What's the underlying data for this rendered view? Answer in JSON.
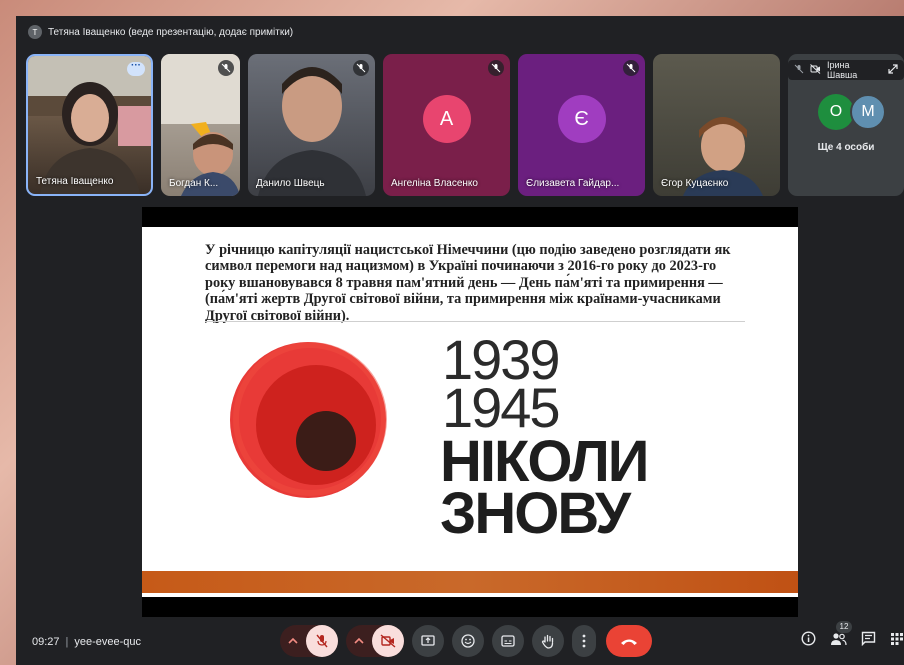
{
  "presenter_banner": {
    "avatar_letter": "Т",
    "text": "Тетяна Іващенко (веде презентацію, додає примітки)"
  },
  "participants": [
    {
      "name": "Тетяна Іващенко",
      "muted": false
    },
    {
      "name": "Богдан К...",
      "muted": true
    },
    {
      "name": "Данило Швець",
      "muted": true
    },
    {
      "name": "Ангеліна Власенко",
      "avatar_letter": "А",
      "muted": true
    },
    {
      "name": "Єлизавета Гайдар...",
      "avatar_letter": "Є",
      "muted": true
    },
    {
      "name": "Єгор Куцаєнко",
      "muted": true
    }
  ],
  "others": {
    "pinned_name": "Ірина Шавша",
    "avatars": [
      "О",
      "М"
    ],
    "count_label": "Ще 4 особи"
  },
  "slide": {
    "text": "У річницю капітуляції нацистської Німеччини (цю подію заведено розглядати як символ перемоги над нацизмом) в Україні починаючи з 2016-го року до 2023-го року вшановувався 8 травня пам'ятний день — День па́м'яті та примирення — (па́м'яті жертв Другої світової війни, та примирення між країнами-учасниками Другої світової війни).",
    "year1": "1939",
    "year2": "1945",
    "slogan1": "НІКОЛИ",
    "slogan2": "ЗНОВУ"
  },
  "bottom": {
    "time": "09:27",
    "meeting_code": "yee-evee-quc",
    "people_count": "12"
  },
  "colors": {
    "meet_bg": "#202124",
    "angelina_tile": "#7a1f4a",
    "angelina_avatar": "#e8456f",
    "yelyzaveta_tile": "#6b1f7f",
    "yelyzaveta_avatar": "#a03dc0",
    "avatar_o": "#1e8e3e",
    "avatar_m": "#5f8fb0",
    "end_call": "#ea4335",
    "poppy_red": "#e52521"
  }
}
